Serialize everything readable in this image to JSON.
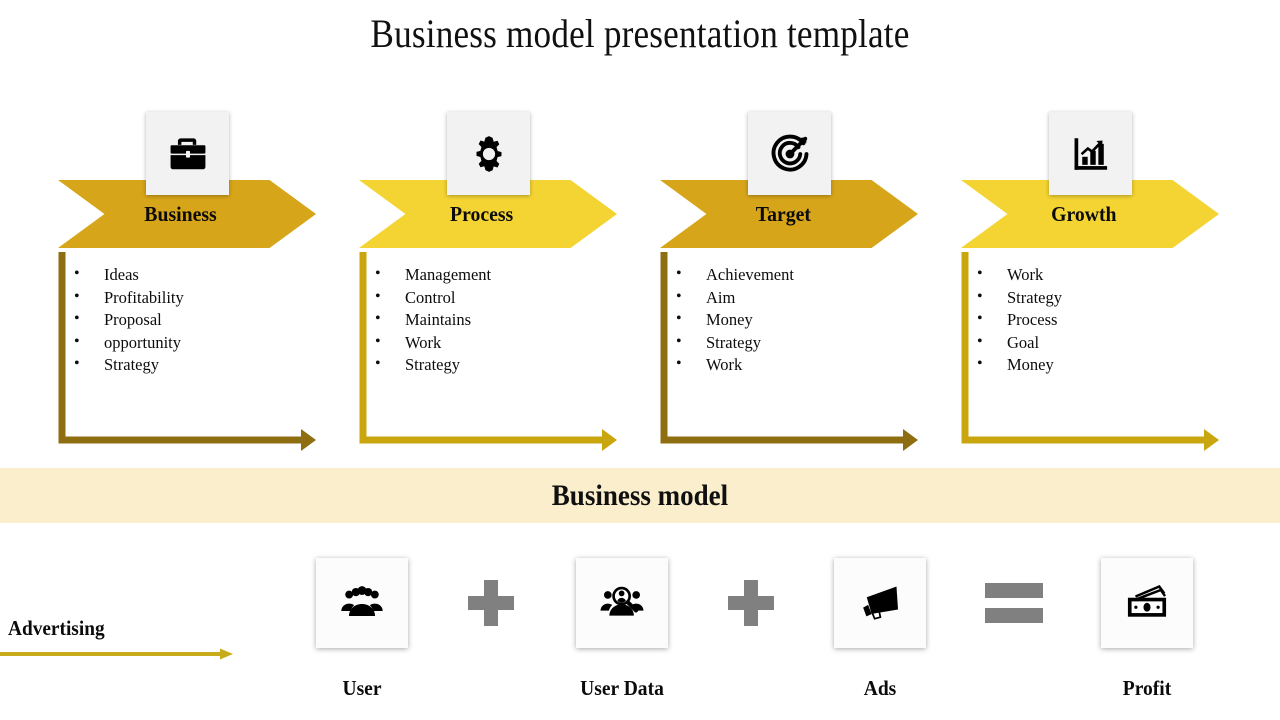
{
  "page_title": "Business model presentation template",
  "pillars": [
    {
      "id": "business",
      "label": "Business",
      "icon": "briefcase-icon",
      "chevron_color": "#D7A519",
      "line_color": "#8F6E12",
      "items": [
        "Ideas",
        "Profitability",
        "Proposal",
        "opportunity",
        "Strategy"
      ]
    },
    {
      "id": "process",
      "label": "Process",
      "icon": "gear-icon",
      "chevron_color": "#F4D433",
      "line_color": "#C9A60E",
      "items": [
        "Management",
        "Control",
        "Maintains",
        "Work",
        "Strategy"
      ]
    },
    {
      "id": "target",
      "label": "Target",
      "icon": "target-icon",
      "chevron_color": "#D7A519",
      "line_color": "#8F6E12",
      "items": [
        "Achievement",
        "Aim",
        "Money",
        "Strategy",
        "Work"
      ]
    },
    {
      "id": "growth",
      "label": "Growth",
      "icon": "bar-chart-growth-icon",
      "chevron_color": "#F4D433",
      "line_color": "#C9A60E",
      "items": [
        "Work",
        "Strategy",
        "Process",
        "Goal",
        "Money"
      ]
    }
  ],
  "band": {
    "label": "Business model",
    "background_color": "#FAEECD"
  },
  "advertising": {
    "label": "Advertising",
    "arrow_color": "#C8AB1A"
  },
  "equation": {
    "items": [
      {
        "id": "user",
        "caption": "User",
        "icon": "users-group-icon"
      },
      {
        "id": "user-data",
        "caption": "User Data",
        "icon": "user-search-icon"
      },
      {
        "id": "ads",
        "caption": "Ads",
        "icon": "megaphone-icon"
      },
      {
        "id": "profit",
        "caption": "Profit",
        "icon": "cash-money-icon"
      }
    ],
    "operators": [
      "plus-icon",
      "plus-icon",
      "equals-icon"
    ],
    "operator_color": "#808080"
  }
}
